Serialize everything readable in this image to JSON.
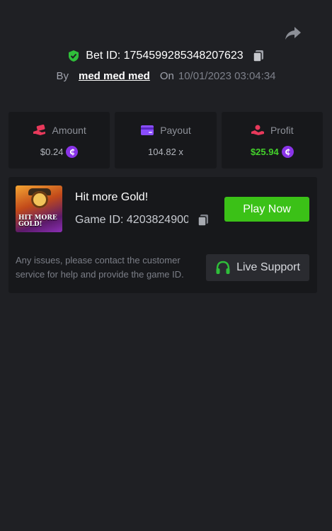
{
  "header": {
    "share_icon": "share-arrow-icon"
  },
  "bet": {
    "label": "Bet ID: 1754599285348207623",
    "verified_icon": "shield-check-icon",
    "copy_icon": "copy-icon"
  },
  "meta": {
    "by_label": "By",
    "username": "med med med",
    "on_label": "On",
    "datetime": "10/01/2023 03:04:34"
  },
  "stats": {
    "amount": {
      "label": "Amount",
      "value": "$0.24",
      "icon": "wallet-hand-icon",
      "coin": "₵"
    },
    "payout": {
      "label": "Payout",
      "value": "104.82 x",
      "icon": "card-icon"
    },
    "profit": {
      "label": "Profit",
      "value": "$25.94",
      "icon": "hand-money-icon",
      "coin": "₵"
    }
  },
  "game": {
    "title": "Hit more Gold!",
    "id_text": "Game ID: 4203824900...",
    "thumb_logo": "HIT MORE GOLD!",
    "play_label": "Play Now",
    "issues_text": "Any issues, please contact the customer service for help and provide the game ID.",
    "support_label": "Live Support",
    "support_icon": "headset-icon"
  },
  "colors": {
    "background": "#1f2024",
    "card": "#17181b",
    "accent_green": "#3bc117",
    "profit_green": "#43d12b",
    "coin_purple": "#8a34e8"
  }
}
